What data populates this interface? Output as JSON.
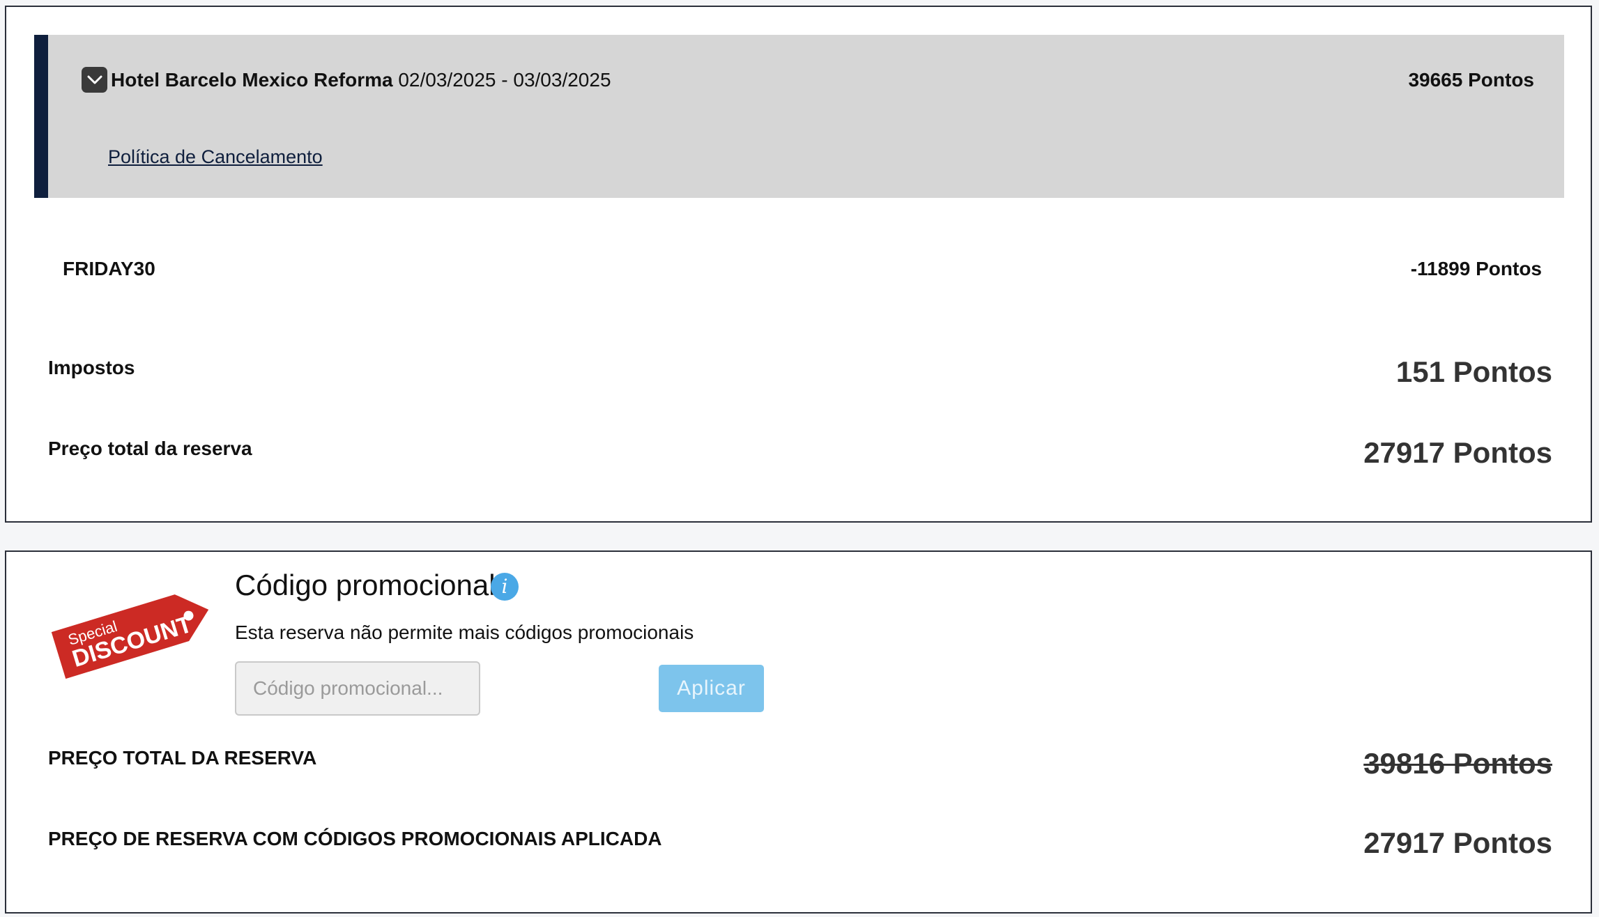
{
  "reservation": {
    "hotel_name": "Hotel Barcelo Mexico Reforma",
    "dates": "02/03/2025 - 03/03/2025",
    "hotel_points": "39665 Pontos",
    "cancel_policy_label": "Política de Cancelamento",
    "discount_code": "FRIDAY30",
    "discount_points": "-11899 Pontos",
    "taxes_label": "Impostos",
    "taxes_points": "151 Pontos",
    "total_label": "Preço total da reserva",
    "total_points": "27917 Pontos"
  },
  "promo": {
    "badge_small": "Special",
    "badge_big": "DISCOUNT",
    "title": "Código promocional",
    "info_icon": "i",
    "description": "Esta reserva não permite mais códigos promocionais",
    "input_placeholder": "Código promocional...",
    "input_value": "",
    "apply_label": "Aplicar",
    "total_label": "PREÇO TOTAL DA RESERVA",
    "original_total": "39816 Pontos",
    "applied_label": "PREÇO DE RESERVA COM CÓDIGOS PROMOCIONAIS APLICADA",
    "applied_total": "27917 Pontos"
  },
  "colors": {
    "accent_navy": "#0f1f3d",
    "hotel_box_bg": "#d6d6d6",
    "apply_button": "#7dc4ec",
    "info_icon": "#4aa8e6",
    "badge_red": "#cc2a24"
  },
  "icons": {
    "collapse": "chevron-down-icon",
    "info": "info-icon",
    "badge": "discount-tag-icon"
  }
}
